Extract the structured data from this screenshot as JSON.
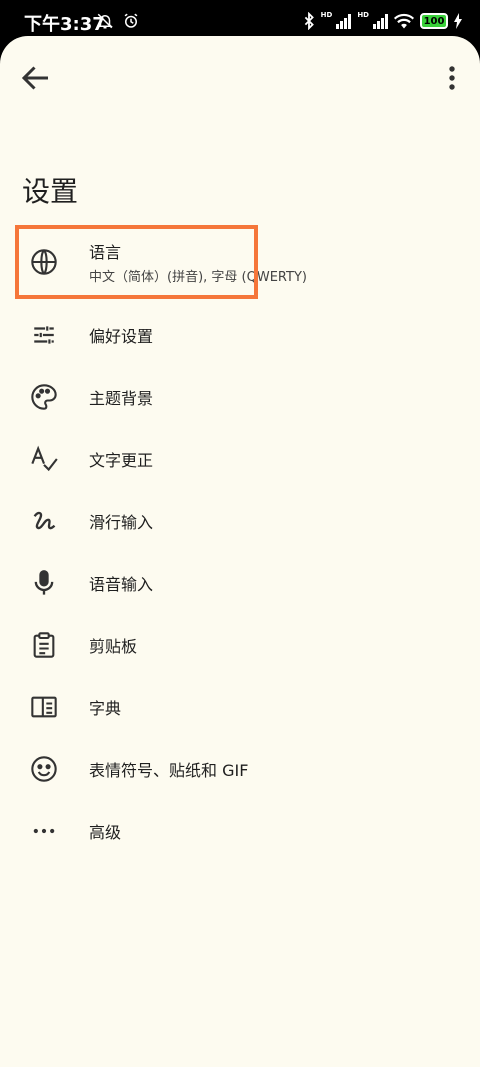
{
  "status_bar": {
    "time": "下午3:37",
    "battery": "100",
    "hd_labels": [
      "HD",
      "HD"
    ]
  },
  "header": {
    "back_icon": "arrow-back-icon",
    "more_icon": "more-vertical-icon"
  },
  "page_title": "设置",
  "menu": [
    {
      "id": "language",
      "icon": "globe-icon",
      "label": "语言",
      "subtitle": "中文（简体）(拼音), 字母 (QWERTY)"
    },
    {
      "id": "preferences",
      "icon": "tune-icon",
      "label": "偏好设置"
    },
    {
      "id": "theme",
      "icon": "palette-icon",
      "label": "主题背景"
    },
    {
      "id": "text-correction",
      "icon": "spellcheck-icon",
      "label": "文字更正"
    },
    {
      "id": "glide-typing",
      "icon": "gesture-icon",
      "label": "滑行输入"
    },
    {
      "id": "voice-input",
      "icon": "mic-icon",
      "label": "语音输入"
    },
    {
      "id": "clipboard",
      "icon": "clipboard-icon",
      "label": "剪贴板"
    },
    {
      "id": "dictionary",
      "icon": "dictionary-icon",
      "label": "字典"
    },
    {
      "id": "emoji",
      "icon": "emoji-icon",
      "label": "表情符号、贴纸和 GIF"
    },
    {
      "id": "advanced",
      "icon": "more-horiz-icon",
      "label": "高级"
    }
  ],
  "colors": {
    "background": "#fdfbf0",
    "highlight": "#f5763a",
    "text": "#1f1f1f"
  }
}
